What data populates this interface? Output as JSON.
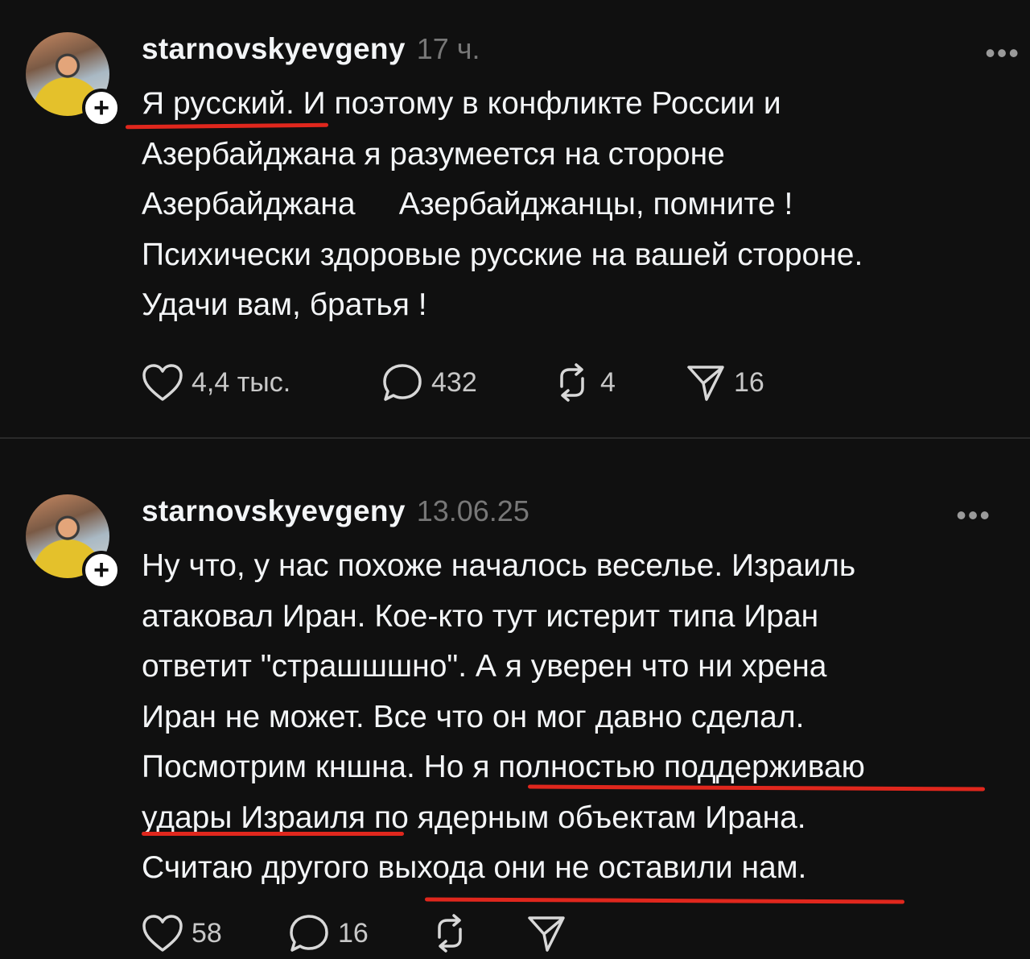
{
  "top_cut_text": "",
  "posts": [
    {
      "username": "starnovskyevgeny",
      "time": "17 ч.",
      "more_label": "•••",
      "lines": [
        "Я русский. И поэтому в конфликте России и",
        "Азербайджана я разумеется на стороне",
        "Азербайджана     Азербайджанцы, помните !",
        "Психически здоровые русские на вашей стороне.",
        "Удачи вам, братья !"
      ],
      "likes": "4,4 тыс.",
      "comments": "432",
      "reposts": "4",
      "shares": "16"
    },
    {
      "username": "starnovskyevgeny",
      "time": "13.06.25",
      "more_label": "•••",
      "lines": [
        "Ну что, у нас похоже началось веселье. Израиль",
        "атаковал Иран. Кое-кто тут истерит типа Иран",
        "ответит \"страшшшно\". А я уверен что ни хрена",
        "Иран не может. Все что он мог давно сделал.",
        "Посмотрим кншна. Но я полностью поддерживаю",
        "удары Израиля по ядерным объектам Ирана.",
        "Считаю другого выхода они не оставили нам."
      ],
      "likes": "58",
      "comments": "16",
      "reposts": "",
      "shares": ""
    }
  ],
  "colors": {
    "background": "#101010",
    "text": "#f3f5f7",
    "muted": "#777777",
    "annotation_red": "#e0271d"
  },
  "icons": [
    "plus-icon",
    "more-icon",
    "heart-icon",
    "comment-icon",
    "repost-icon",
    "share-icon"
  ]
}
